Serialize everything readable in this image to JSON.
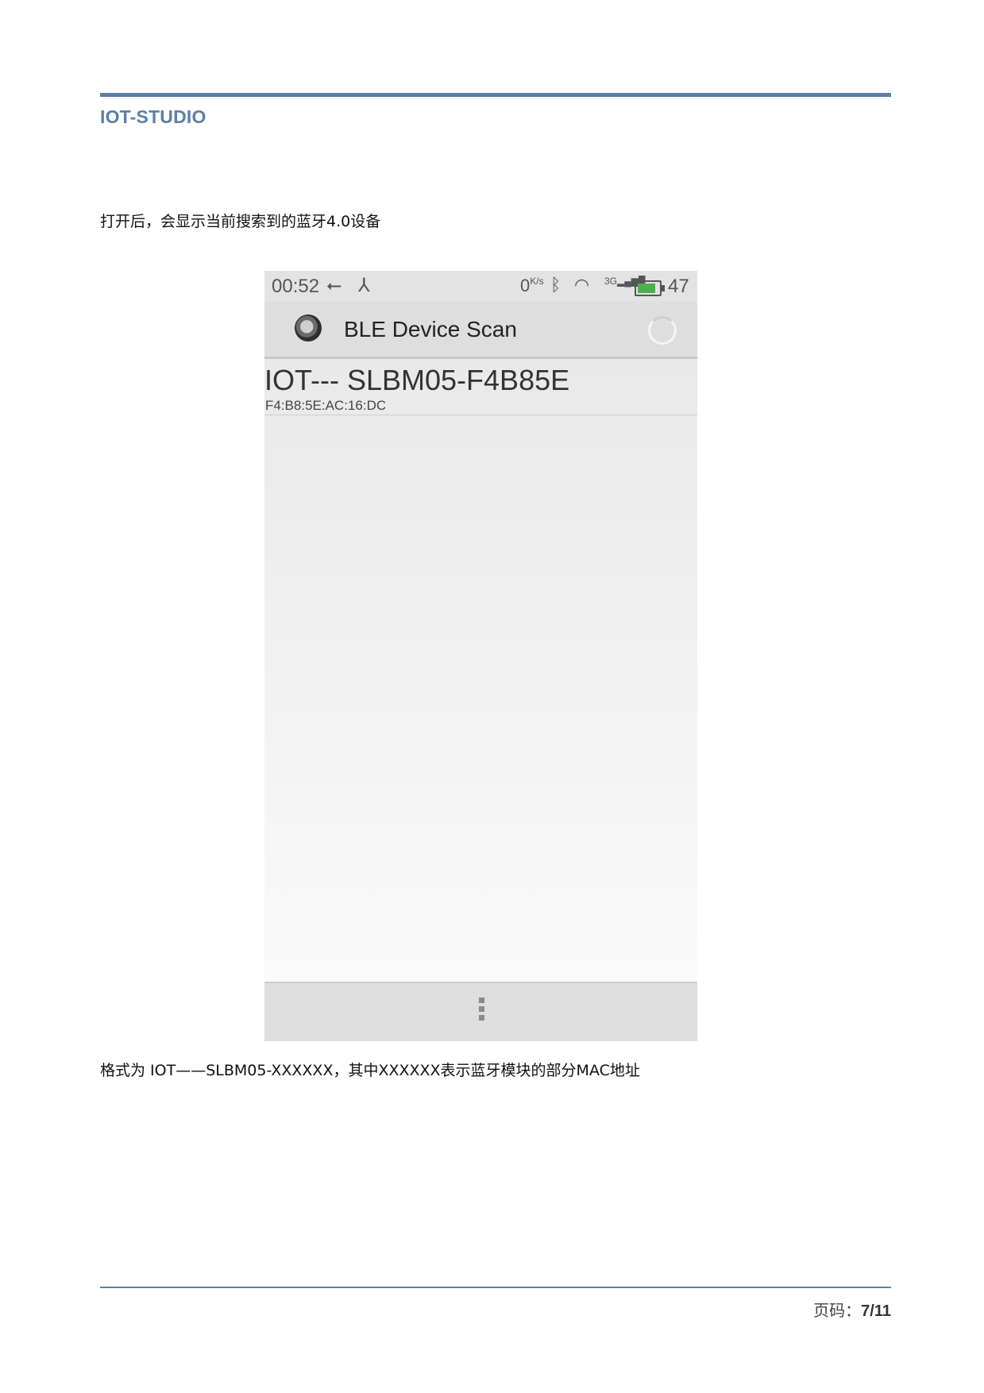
{
  "header": {
    "title": "IOT-STUDIO"
  },
  "intro_text": "打开后，会显示当前搜索到的蓝牙4.0设备",
  "phone": {
    "status_bar": {
      "time": "00:52",
      "net_speed": "0",
      "net_speed_unit": "K/s",
      "network_type": "3G",
      "battery_level": "47",
      "icons": [
        "usb-icon",
        "share-icon",
        "bluetooth-icon",
        "wifi-icon",
        "signal-icon",
        "battery-icon"
      ]
    },
    "action_bar": {
      "title": "BLE Device Scan"
    },
    "devices": [
      {
        "name": "IOT--- SLBM05-F4B85E",
        "mac": "F4:B8:5E:AC:16:DC"
      }
    ]
  },
  "caption_text": "格式为 IOT——SLBM05-XXXXXX，其中XXXXXX表示蓝牙模块的部分MAC地址",
  "footer": {
    "page_label": "页码：",
    "page_number": "7/11"
  },
  "colors": {
    "accent": "#5b7fa6",
    "battery": "#4caf50"
  }
}
